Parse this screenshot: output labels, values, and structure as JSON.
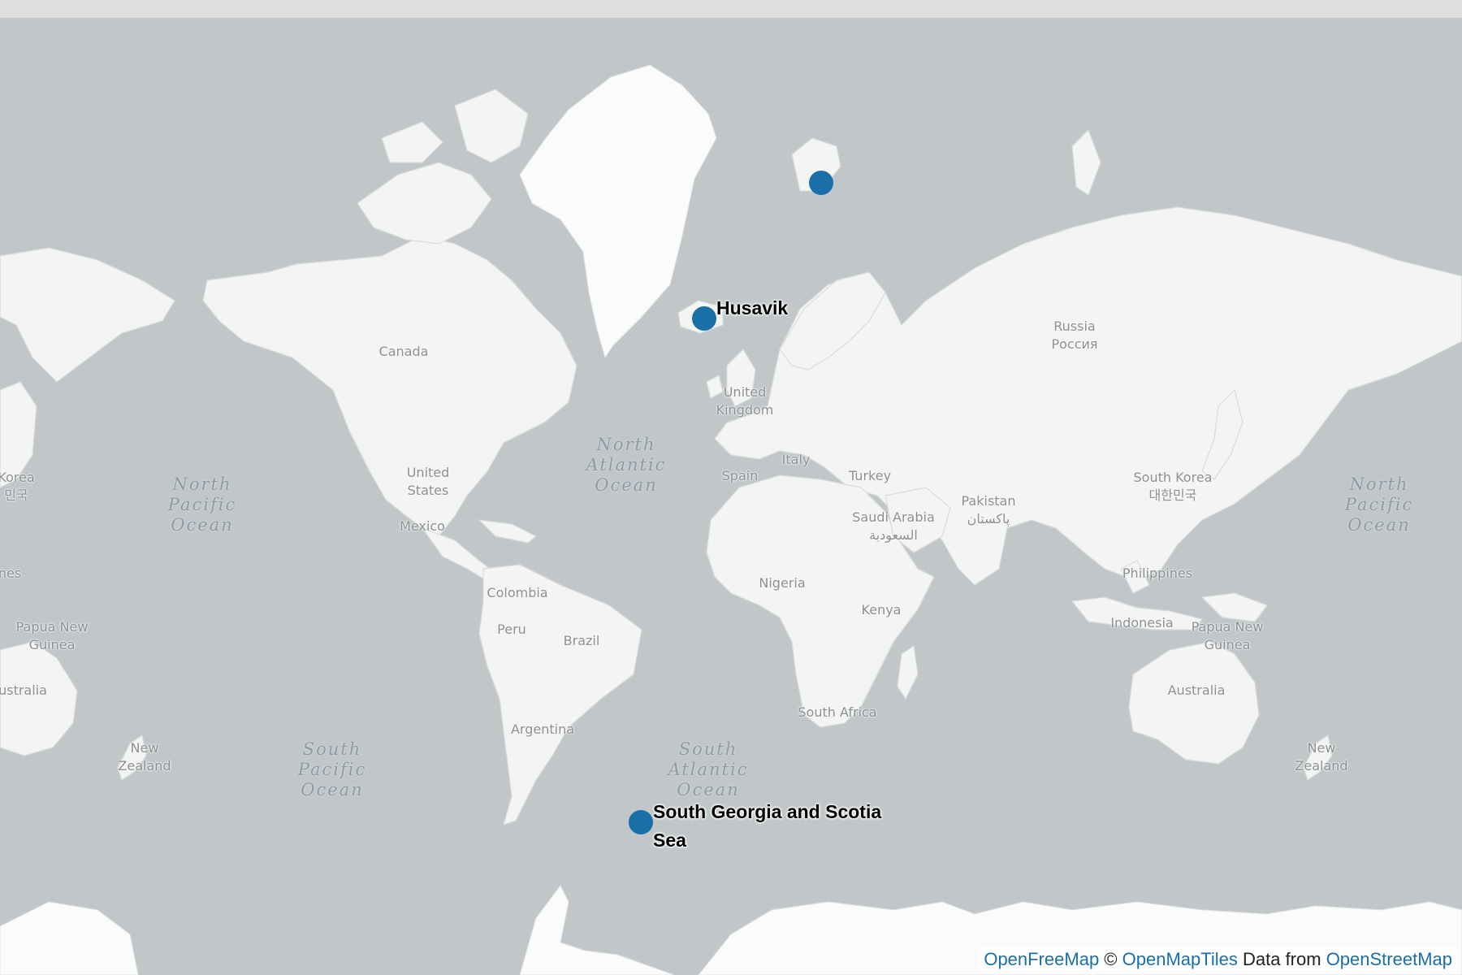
{
  "map": {
    "ocean_color": "#c1c7c9",
    "land_color": "#f4f4f3",
    "marker_color": "#1a6fa8",
    "countries": [
      {
        "id": "canada",
        "text": "Canada"
      },
      {
        "id": "united-states",
        "text": "United\nStates"
      },
      {
        "id": "mexico",
        "text": "Mexico"
      },
      {
        "id": "colombia",
        "text": "Colombia"
      },
      {
        "id": "peru",
        "text": "Peru"
      },
      {
        "id": "brazil",
        "text": "Brazil"
      },
      {
        "id": "argentina",
        "text": "Argentina"
      },
      {
        "id": "united-kingdom",
        "text": "United\nKingdom"
      },
      {
        "id": "spain",
        "text": "Spain"
      },
      {
        "id": "italy",
        "text": "Italy"
      },
      {
        "id": "turkey",
        "text": "Turkey"
      },
      {
        "id": "russia",
        "text": "Russia\nРоссия"
      },
      {
        "id": "saudi-arabia",
        "text": "Saudi Arabia\nالسعودية"
      },
      {
        "id": "pakistan",
        "text": "Pakistan\nپاکستان"
      },
      {
        "id": "nigeria",
        "text": "Nigeria"
      },
      {
        "id": "kenya",
        "text": "Kenya"
      },
      {
        "id": "south-africa",
        "text": "South Africa"
      },
      {
        "id": "south-korea",
        "text": "South Korea\n대한민국"
      },
      {
        "id": "south-korea-west",
        "text": "Korea\n민국"
      },
      {
        "id": "philippines",
        "text": "Philippines"
      },
      {
        "id": "philippines-west",
        "text": "nes"
      },
      {
        "id": "indonesia",
        "text": "Indonesia"
      },
      {
        "id": "papua-new-guinea",
        "text": "Papua New\nGuinea"
      },
      {
        "id": "papua-new-guinea-west",
        "text": "Papua New\nGuinea"
      },
      {
        "id": "australia",
        "text": "Australia"
      },
      {
        "id": "australia-west",
        "text": "ustralia"
      },
      {
        "id": "new-zealand",
        "text": "New\nZealand"
      },
      {
        "id": "new-zealand-west",
        "text": "New\nZealand"
      }
    ],
    "oceans": [
      {
        "id": "north-pacific-west",
        "text": "North\nPacific\nOcean"
      },
      {
        "id": "north-pacific-east",
        "text": "North\nPacific\nOcean"
      },
      {
        "id": "north-atlantic",
        "text": "North\nAtlantic\nOcean"
      },
      {
        "id": "south-pacific",
        "text": "South\nPacific\nOcean"
      },
      {
        "id": "south-atlantic",
        "text": "South\nAtlantic\nOcean"
      }
    ],
    "markers": [
      {
        "id": "svalbard",
        "label": ""
      },
      {
        "id": "husavik",
        "label": "Husavik"
      },
      {
        "id": "south-georgia",
        "label": "South Georgia and Scotia\nSea"
      }
    ]
  },
  "attribution": {
    "openfreemap": "OpenFreeMap",
    "copy": " © ",
    "openmaptiles": "OpenMapTiles",
    "data_from": " Data from ",
    "openstreetmap": "OpenStreetMap"
  }
}
